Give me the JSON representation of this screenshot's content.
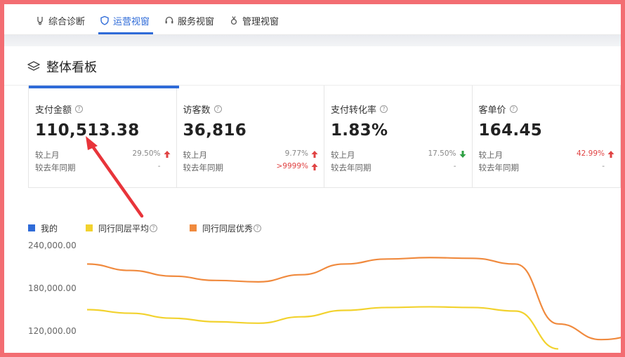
{
  "tabs": [
    {
      "label": "综合诊断",
      "icon": "diagnosis-icon"
    },
    {
      "label": "运营视窗",
      "icon": "shield-icon",
      "active": true
    },
    {
      "label": "服务视窗",
      "icon": "headset-icon"
    },
    {
      "label": "管理视窗",
      "icon": "medal-icon"
    }
  ],
  "panel": {
    "title": "整体看板",
    "icon": "layers-icon"
  },
  "compare_labels": {
    "month": "较上月",
    "year": "较去年同期"
  },
  "metrics": [
    {
      "label": "支付金额",
      "value": "110,513.38",
      "month_change": "29.50%",
      "month_dir": "up",
      "year_change": "-",
      "year_dir": "none"
    },
    {
      "label": "访客数",
      "value": "36,816",
      "month_change": "9.77%",
      "month_dir": "up",
      "year_change": ">9999%",
      "year_dir": "up"
    },
    {
      "label": "支付转化率",
      "value": "1.83%",
      "month_change": "17.50%",
      "month_dir": "down",
      "year_change": "-",
      "year_dir": "none"
    },
    {
      "label": "客单价",
      "value": "164.45",
      "month_change": "42.99%",
      "month_dir": "up",
      "year_change": "-",
      "year_dir": "none"
    }
  ],
  "colors": {
    "accent": "#2f6bd8",
    "up": "#e04343",
    "down": "#2ea043",
    "mine": "#2f6bd8",
    "peer_avg": "#f2d22e",
    "peer_top": "#f08a3e",
    "annotation": "#e8343a"
  },
  "chart_data": {
    "type": "line",
    "legend": [
      "我的",
      "同行同层平均",
      "同行同层优秀"
    ],
    "yticks": [
      "240,000.00",
      "180,000.00",
      "120,000.00"
    ],
    "ylim": [
      120000,
      240000
    ],
    "series": [
      {
        "name": "同行同层平均",
        "values": [
          150000,
          145000,
          138000,
          133000,
          131000,
          140000,
          149000,
          153000,
          154000,
          153000,
          148000,
          95000
        ]
      },
      {
        "name": "同行同层优秀",
        "values": [
          214000,
          205000,
          197000,
          191000,
          189000,
          199000,
          214000,
          221000,
          223000,
          222000,
          214000,
          130000,
          108000,
          115000
        ]
      }
    ]
  }
}
